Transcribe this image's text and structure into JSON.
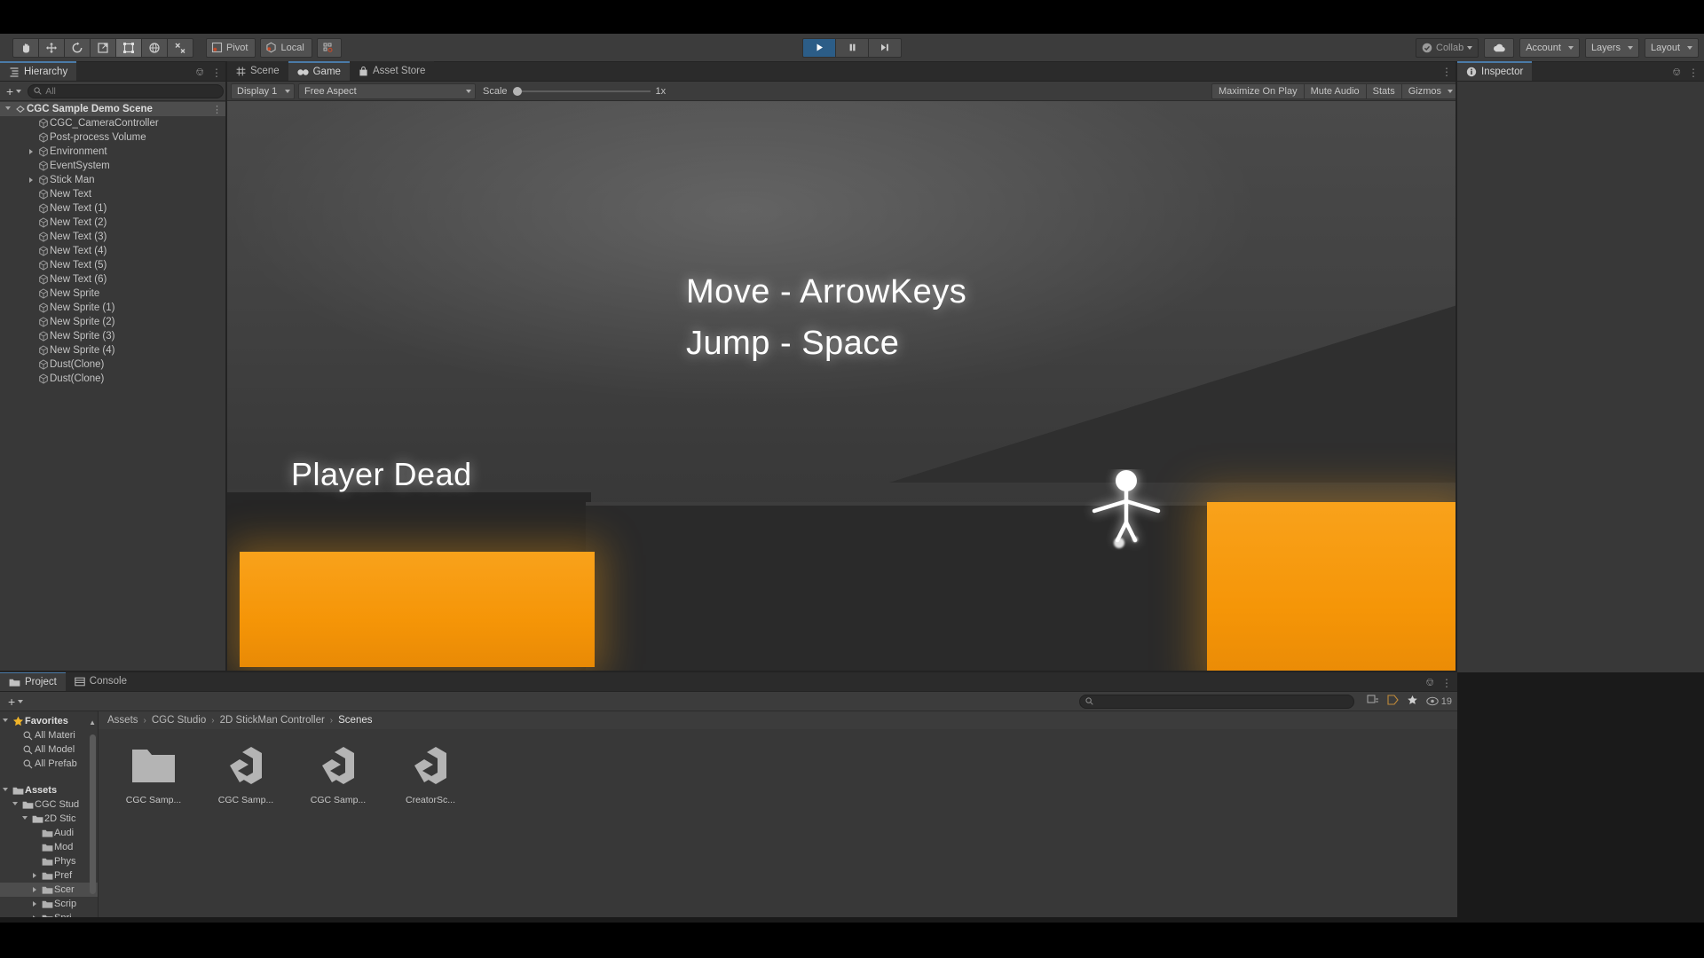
{
  "toolbar": {
    "tools": [
      {
        "name": "hand-tool",
        "icon": "hand"
      },
      {
        "name": "move-tool",
        "icon": "move"
      },
      {
        "name": "rotate-tool",
        "icon": "rotate"
      },
      {
        "name": "scale-tool",
        "icon": "scale"
      },
      {
        "name": "rect-tool",
        "icon": "rect"
      },
      {
        "name": "transform-tool",
        "icon": "transform"
      },
      {
        "name": "custom-tool",
        "icon": "wrench"
      }
    ],
    "pivot_label": "Pivot",
    "local_label": "Local",
    "play_label": "▶",
    "pause_label": "‖",
    "step_label": "▶|",
    "collab_label": "Collab",
    "account_label": "Account",
    "layers_label": "Layers",
    "layout_label": "Layout"
  },
  "hierarchy": {
    "tab_label": "Hierarchy",
    "search_placeholder": "All",
    "add_label": "+",
    "items": [
      {
        "label": "CGC Sample Demo Scene",
        "depth": 0,
        "expander": "open",
        "icon": "scene",
        "selected": true,
        "is_scene": true
      },
      {
        "label": "CGC_CameraController",
        "depth": 2,
        "expander": "none",
        "icon": "gameobject"
      },
      {
        "label": "Post-process Volume",
        "depth": 2,
        "expander": "none",
        "icon": "gameobject"
      },
      {
        "label": "Environment",
        "depth": 2,
        "expander": "closed",
        "icon": "gameobject"
      },
      {
        "label": "EventSystem",
        "depth": 2,
        "expander": "none",
        "icon": "gameobject"
      },
      {
        "label": "Stick Man",
        "depth": 2,
        "expander": "closed",
        "icon": "gameobject"
      },
      {
        "label": "New Text",
        "depth": 2,
        "expander": "none",
        "icon": "gameobject"
      },
      {
        "label": "New Text (1)",
        "depth": 2,
        "expander": "none",
        "icon": "gameobject"
      },
      {
        "label": "New Text (2)",
        "depth": 2,
        "expander": "none",
        "icon": "gameobject"
      },
      {
        "label": "New Text (3)",
        "depth": 2,
        "expander": "none",
        "icon": "gameobject"
      },
      {
        "label": "New Text (4)",
        "depth": 2,
        "expander": "none",
        "icon": "gameobject"
      },
      {
        "label": "New Text (5)",
        "depth": 2,
        "expander": "none",
        "icon": "gameobject"
      },
      {
        "label": "New Text (6)",
        "depth": 2,
        "expander": "none",
        "icon": "gameobject"
      },
      {
        "label": "New Sprite",
        "depth": 2,
        "expander": "none",
        "icon": "gameobject"
      },
      {
        "label": "New Sprite (1)",
        "depth": 2,
        "expander": "none",
        "icon": "gameobject"
      },
      {
        "label": "New Sprite (2)",
        "depth": 2,
        "expander": "none",
        "icon": "gameobject"
      },
      {
        "label": "New Sprite (3)",
        "depth": 2,
        "expander": "none",
        "icon": "gameobject"
      },
      {
        "label": "New Sprite (4)",
        "depth": 2,
        "expander": "none",
        "icon": "gameobject"
      },
      {
        "label": "Dust(Clone)",
        "depth": 2,
        "expander": "none",
        "icon": "gameobject"
      },
      {
        "label": "Dust(Clone)",
        "depth": 2,
        "expander": "none",
        "icon": "gameobject"
      }
    ]
  },
  "gameview": {
    "tabs": [
      {
        "label": "Scene",
        "icon": "grid-icon",
        "active": false
      },
      {
        "label": "Game",
        "icon": "gamepad-icon",
        "active": true
      },
      {
        "label": "Asset Store",
        "icon": "store-icon",
        "active": false
      }
    ],
    "display_label": "Display 1",
    "aspect_label": "Free Aspect",
    "scale_label": "Scale",
    "scale_value": "1x",
    "maximize_label": "Maximize On Play",
    "mute_label": "Mute Audio",
    "stats_label": "Stats",
    "gizmos_label": "Gizmos",
    "scene_text": {
      "move_hint": "Move - ArrowKeys",
      "jump_hint": "Jump - Space",
      "player_dead": "Player Dead"
    },
    "colors": {
      "orange_block": "#f59507",
      "ground": "#2a2a2a",
      "sky_top": "#4a4a4a"
    }
  },
  "inspector": {
    "tab_label": "Inspector"
  },
  "project": {
    "tabs": [
      {
        "label": "Project",
        "icon": "folder-icon",
        "active": true
      },
      {
        "label": "Console",
        "icon": "console-icon",
        "active": false
      }
    ],
    "add_label": "+",
    "search_placeholder": "",
    "badge_count": "19",
    "breadcrumb": [
      "Assets",
      "CGC Studio",
      "2D StickMan Controller",
      "Scenes"
    ],
    "tree": [
      {
        "label": "Favorites",
        "depth": 0,
        "expander": "open",
        "icon": "star",
        "bold": true
      },
      {
        "label": "All Materi",
        "depth": 1,
        "expander": "none",
        "icon": "search"
      },
      {
        "label": "All Model",
        "depth": 1,
        "expander": "none",
        "icon": "search"
      },
      {
        "label": "All Prefab",
        "depth": 1,
        "expander": "none",
        "icon": "search"
      },
      {
        "label": "",
        "depth": 0,
        "expander": "none",
        "icon": "none"
      },
      {
        "label": "Assets",
        "depth": 0,
        "expander": "open",
        "icon": "folder-open",
        "bold": true
      },
      {
        "label": "CGC Stud",
        "depth": 1,
        "expander": "open",
        "icon": "folder-open"
      },
      {
        "label": "2D Stic",
        "depth": 2,
        "expander": "open",
        "icon": "folder-open"
      },
      {
        "label": "Audi",
        "depth": 3,
        "expander": "none",
        "icon": "folder"
      },
      {
        "label": "Mod",
        "depth": 3,
        "expander": "none",
        "icon": "folder"
      },
      {
        "label": "Phys",
        "depth": 3,
        "expander": "none",
        "icon": "folder"
      },
      {
        "label": "Pref",
        "depth": 3,
        "expander": "closed",
        "icon": "folder"
      },
      {
        "label": "Scer",
        "depth": 3,
        "expander": "closed",
        "icon": "folder",
        "selected": true
      },
      {
        "label": "Scrip",
        "depth": 3,
        "expander": "closed",
        "icon": "folder"
      },
      {
        "label": "Spri",
        "depth": 3,
        "expander": "closed",
        "icon": "folder"
      }
    ],
    "assets": [
      {
        "name": "CGC Samp...",
        "icon": "folder"
      },
      {
        "name": "CGC Samp...",
        "icon": "unity-scene"
      },
      {
        "name": "CGC Samp...",
        "icon": "unity-scene"
      },
      {
        "name": "CreatorSc...",
        "icon": "unity-scene"
      }
    ]
  }
}
